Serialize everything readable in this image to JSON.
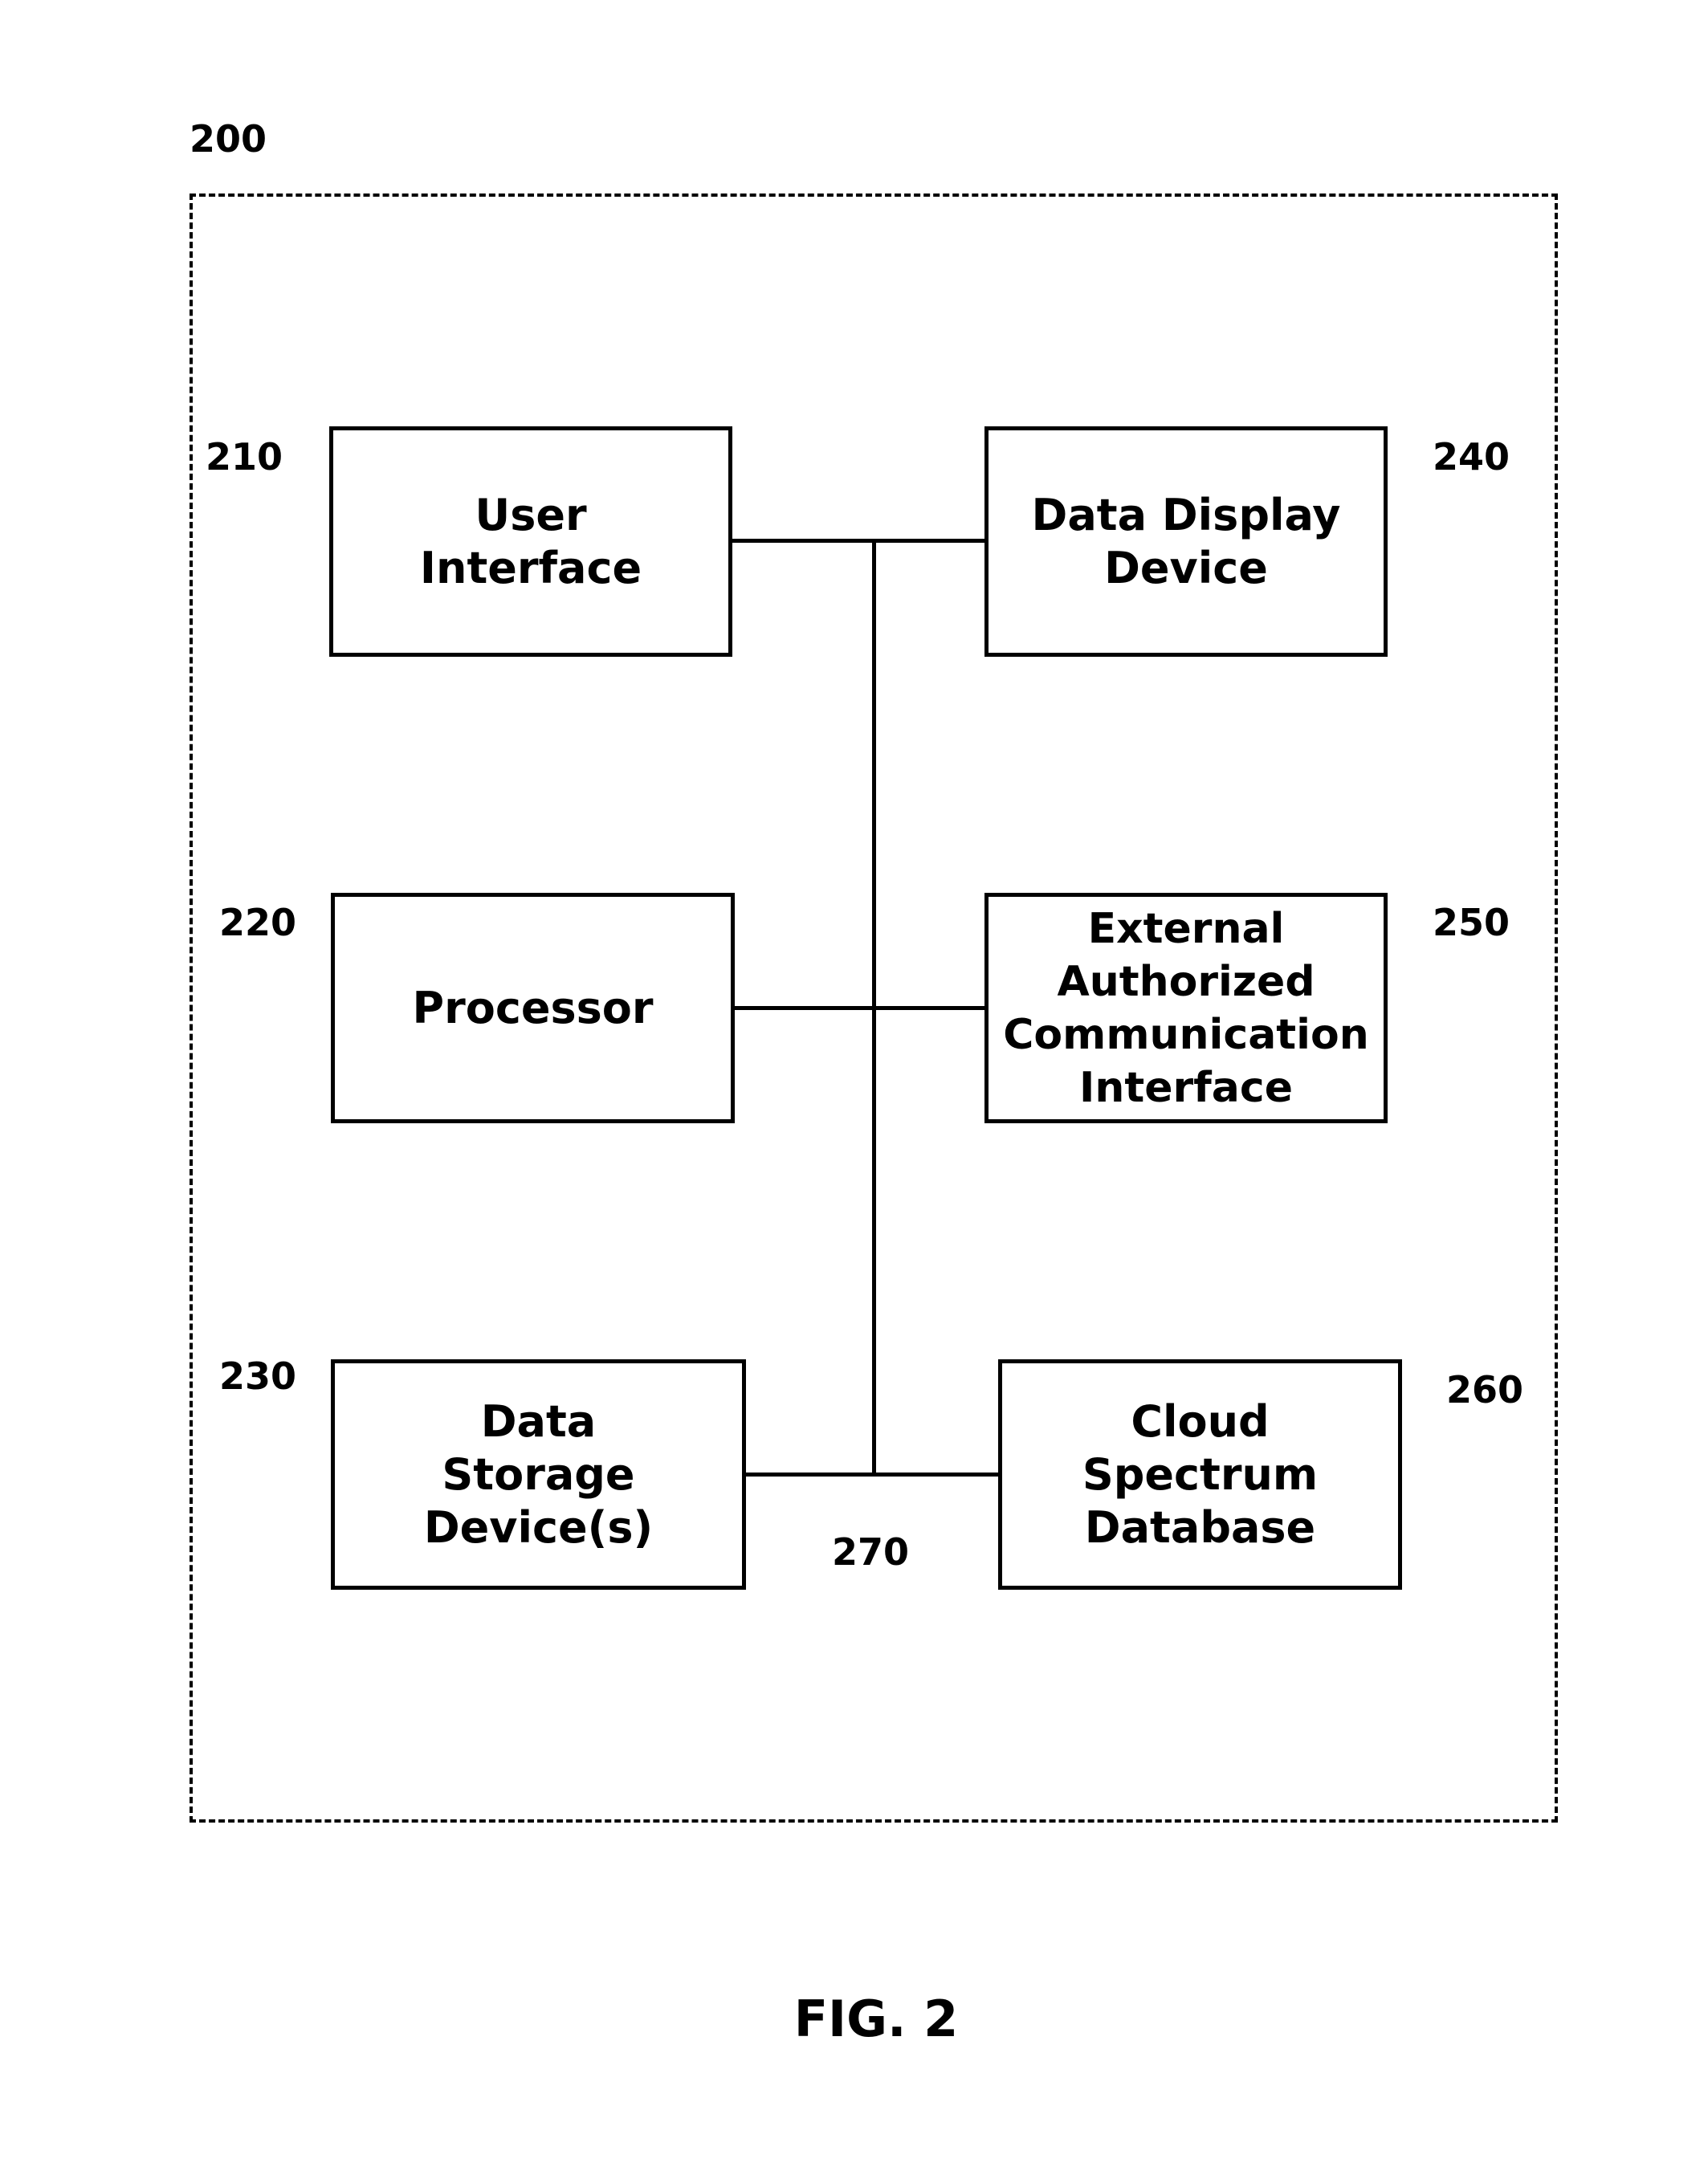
{
  "figure": {
    "caption": "FIG. 2",
    "system_ref": "200",
    "bus_ref": "270",
    "components": [
      {
        "ref": "210",
        "label": "User\nInterface"
      },
      {
        "ref": "220",
        "label": "Processor"
      },
      {
        "ref": "230",
        "label": "Data\nStorage\nDevice(s)"
      },
      {
        "ref": "240",
        "label": "Data Display\nDevice"
      },
      {
        "ref": "250",
        "label": "External\nAuthorized\nCommunication\nInterface"
      },
      {
        "ref": "260",
        "label": "Cloud\nSpectrum\nDatabase"
      }
    ],
    "connections": [
      {
        "from": "210",
        "to": "240",
        "via": "270"
      },
      {
        "from": "220",
        "to": "250",
        "via": "270"
      },
      {
        "from": "230",
        "to": "260",
        "via": "270"
      }
    ]
  }
}
